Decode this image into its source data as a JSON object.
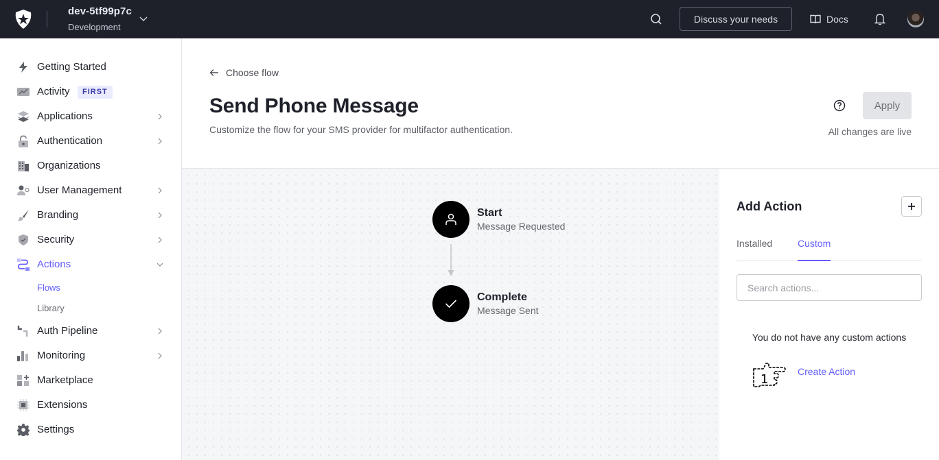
{
  "topbar": {
    "tenant_name": "dev-5tf99p7c",
    "tenant_env": "Development",
    "discuss_label": "Discuss your needs",
    "docs_label": "Docs"
  },
  "sidebar": {
    "items": [
      {
        "label": "Getting Started",
        "icon": "bolt-icon"
      },
      {
        "label": "Activity",
        "icon": "activity-chart-icon",
        "badge": "FIRST"
      },
      {
        "label": "Applications",
        "icon": "layers-icon",
        "has_chevron": true
      },
      {
        "label": "Authentication",
        "icon": "unlock-icon",
        "has_chevron": true
      },
      {
        "label": "Organizations",
        "icon": "building-icon"
      },
      {
        "label": "User Management",
        "icon": "user-gear-icon",
        "has_chevron": true
      },
      {
        "label": "Branding",
        "icon": "brush-icon",
        "has_chevron": true
      },
      {
        "label": "Security",
        "icon": "shield-check-icon",
        "has_chevron": true
      },
      {
        "label": "Actions",
        "icon": "actions-flow-icon",
        "expanded": true,
        "active": true,
        "children": [
          {
            "label": "Flows",
            "active": true
          },
          {
            "label": "Library"
          }
        ]
      },
      {
        "label": "Auth Pipeline",
        "icon": "pipeline-icon",
        "has_chevron": true
      },
      {
        "label": "Monitoring",
        "icon": "bar-chart-icon",
        "has_chevron": true
      },
      {
        "label": "Marketplace",
        "icon": "grid-plus-icon"
      },
      {
        "label": "Extensions",
        "icon": "chip-icon"
      },
      {
        "label": "Settings",
        "icon": "gear-icon"
      }
    ]
  },
  "header": {
    "back_label": "Choose flow",
    "title": "Send Phone Message",
    "subtitle": "Customize the flow for your SMS provider for multifactor authentication.",
    "apply_label": "Apply",
    "live_text": "All changes are live"
  },
  "flow": {
    "nodes": [
      {
        "title": "Start",
        "subtitle": "Message Requested",
        "icon": "user-icon"
      },
      {
        "title": "Complete",
        "subtitle": "Message Sent",
        "icon": "check-icon"
      }
    ]
  },
  "panel": {
    "title": "Add Action",
    "tabs": [
      {
        "label": "Installed",
        "active": false
      },
      {
        "label": "Custom",
        "active": true
      }
    ],
    "search_placeholder": "Search actions...",
    "empty_text": "You do not have any custom actions",
    "create_label": "Create Action",
    "cursor_label": "1"
  },
  "colors": {
    "topbar_bg": "#1e212a",
    "accent": "#635dff",
    "canvas_bg": "#f5f6f8",
    "badge_bg": "#ebebff"
  }
}
